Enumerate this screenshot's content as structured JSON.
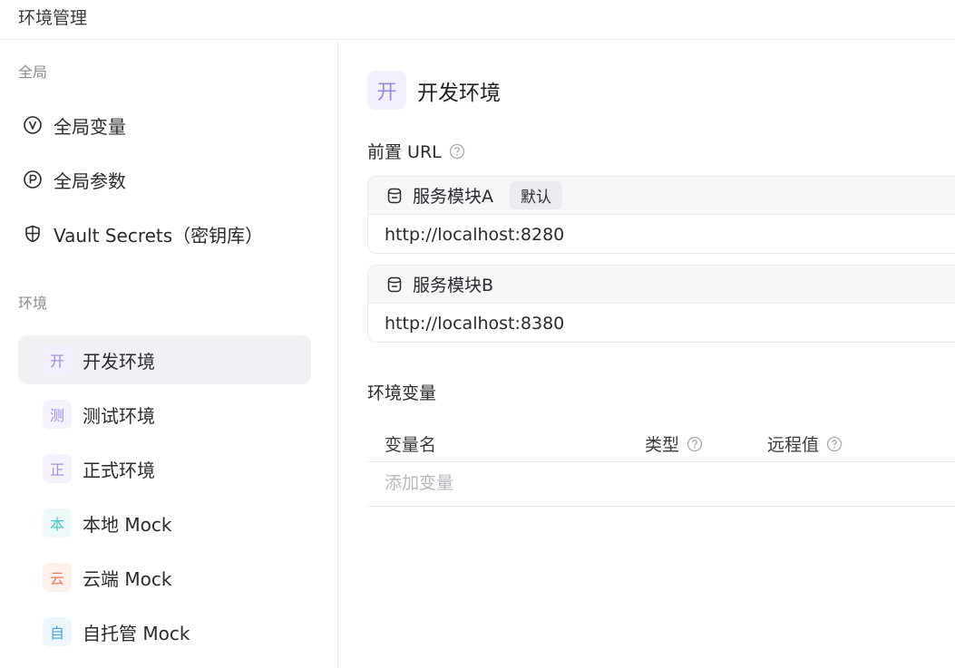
{
  "header": {
    "title": "环境管理"
  },
  "sidebar": {
    "global_section": "全局",
    "global_items": [
      {
        "label": "全局变量",
        "icon": "v-circle-icon"
      },
      {
        "label": "全局参数",
        "icon": "p-circle-icon"
      },
      {
        "label": "Vault Secrets（密钥库）",
        "icon": "shield-icon"
      }
    ],
    "env_section": "环境",
    "env_items": [
      {
        "label": "开发环境",
        "badge": "开",
        "color": "#9a86e8",
        "bg": "#f3f0fe",
        "active": true
      },
      {
        "label": "测试环境",
        "badge": "测",
        "color": "#a48ee6",
        "bg": "#f5f2fd",
        "active": false
      },
      {
        "label": "正式环境",
        "badge": "正",
        "color": "#a48ee6",
        "bg": "#f5f2fd",
        "active": false
      },
      {
        "label": "本地 Mock",
        "badge": "本",
        "color": "#4cc8c2",
        "bg": "#eefaf9",
        "active": false
      },
      {
        "label": "云端 Mock",
        "badge": "云",
        "color": "#ee7a5e",
        "bg": "#fdf1ee",
        "active": false
      },
      {
        "label": "自托管 Mock",
        "badge": "自",
        "color": "#4aa3e8",
        "bg": "#eef6fd",
        "active": false
      }
    ]
  },
  "main": {
    "env_badge": "开",
    "env_name": "开发环境",
    "prefix_url_title": "前置 URL",
    "services": [
      {
        "name": "服务模块A",
        "tag": "默认",
        "url": "http://localhost:8280"
      },
      {
        "name": "服务模块B",
        "tag": "",
        "url": "http://localhost:8380"
      }
    ],
    "env_vars_title": "环境变量",
    "table": {
      "col_name": "变量名",
      "col_type": "类型",
      "col_remote": "远程值",
      "add_placeholder": "添加变量"
    }
  }
}
